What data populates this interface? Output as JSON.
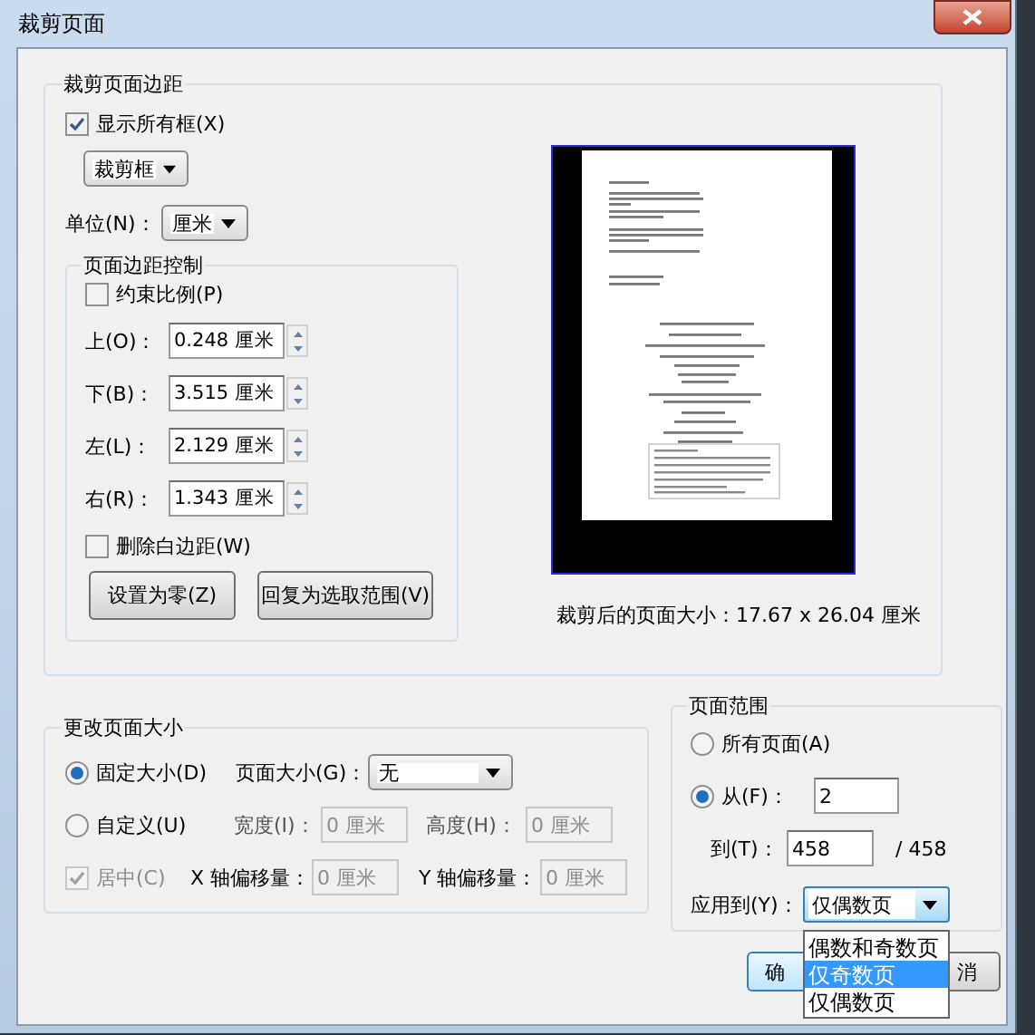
{
  "window": {
    "title": "裁剪页面"
  },
  "crop_margins": {
    "title": "裁剪页面边距",
    "show_all_boxes": {
      "label": "显示所有框(X)",
      "checked": true
    },
    "box_select": {
      "value": "裁剪框"
    },
    "unit": {
      "label": "单位(N)：",
      "value": "厘米"
    },
    "margin_controls": {
      "title": "页面边距控制",
      "constrain": {
        "label": "约束比例(P)",
        "checked": false
      },
      "margins": [
        {
          "label": "上(O)：",
          "value": "0.248 厘米"
        },
        {
          "label": "下(B)：",
          "value": "3.515 厘米"
        },
        {
          "label": "左(L)：",
          "value": "2.129 厘米"
        },
        {
          "label": "右(R)：",
          "value": "1.343 厘米"
        }
      ],
      "remove_white": {
        "label": "删除白边距(W)",
        "checked": false
      },
      "buttons": [
        "设置为零(Z)",
        "回复为选取范围(V)"
      ]
    },
    "preview_caption": "裁剪后的页面大小：17.67 x 26.04 厘米"
  },
  "page_size": {
    "title": "更改页面大小",
    "modes": [
      {
        "label": "固定大小(D)",
        "selected": true
      },
      {
        "label": "自定义(U)",
        "selected": false
      }
    ],
    "size": {
      "label": "页面大小(G)：",
      "value": "无"
    },
    "width": {
      "label": "宽度(I)：",
      "value": "0 厘米",
      "disabled": true
    },
    "height": {
      "label": "高度(H)：",
      "value": "0 厘米",
      "disabled": true
    },
    "center": {
      "label": "居中(C)",
      "checked": true,
      "disabled": true
    },
    "x_offset": {
      "label": "X 轴偏移量：",
      "value": "0 厘米",
      "disabled": true
    },
    "y_offset": {
      "label": "Y 轴偏移量：",
      "value": "0 厘米",
      "disabled": true
    }
  },
  "page_range": {
    "title": "页面范围",
    "options": [
      {
        "label": "所有页面(A)",
        "selected": false
      },
      {
        "label": "从(F)：",
        "selected": true
      }
    ],
    "from": "2",
    "to_label": "到(T)：",
    "to": "458",
    "total": "/ 458",
    "apply_to": {
      "label": "应用到(Y)：",
      "value": "仅偶数页",
      "options": [
        {
          "label": "偶数和奇数页",
          "highlighted": false
        },
        {
          "label": "仅奇数页",
          "highlighted": true
        },
        {
          "label": "仅偶数页",
          "highlighted": false
        }
      ]
    }
  },
  "buttons": [
    "确",
    "消"
  ]
}
